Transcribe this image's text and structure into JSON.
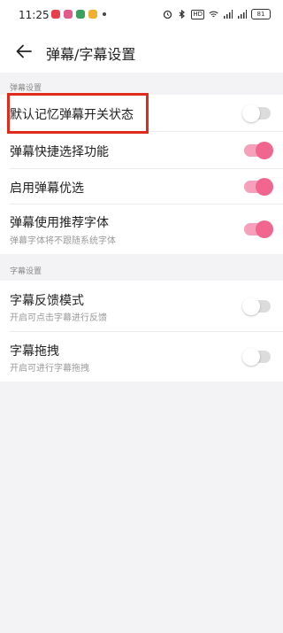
{
  "status_bar": {
    "time": "11:25",
    "network_badge": "HD",
    "battery": "81"
  },
  "nav": {
    "title": "弹幕/字幕设置",
    "back_icon": "arrow-left-icon"
  },
  "sections": [
    {
      "header": "弹幕设置",
      "items": [
        {
          "title": "默认记忆弹幕开关状态",
          "subtitle": "",
          "enabled": false
        },
        {
          "title": "弹幕快捷选择功能",
          "subtitle": "",
          "enabled": true
        },
        {
          "title": "启用弹幕优选",
          "subtitle": "",
          "enabled": true
        },
        {
          "title": "弹幕使用推荐字体",
          "subtitle": "弹幕字体将不跟随系统字体",
          "enabled": true
        }
      ]
    },
    {
      "header": "字幕设置",
      "items": [
        {
          "title": "字幕反馈模式",
          "subtitle": "开启可点击字幕进行反馈",
          "enabled": false
        },
        {
          "title": "字幕拖拽",
          "subtitle": "开启可进行字幕拖拽",
          "enabled": false
        }
      ]
    }
  ],
  "colors": {
    "accent": "#f0668f",
    "highlight": "#e02a1a"
  }
}
